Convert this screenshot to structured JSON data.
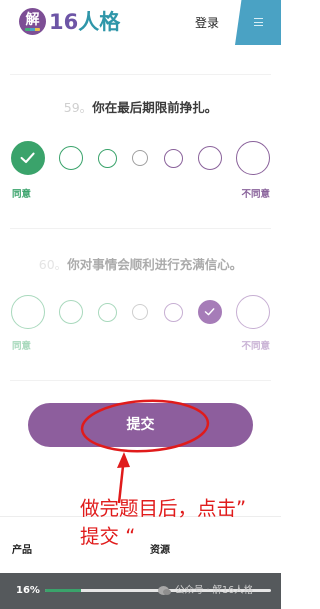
{
  "header": {
    "logo_mark": "解",
    "logo_num": "16",
    "logo_word": "人格",
    "login": "登录",
    "menu_icon": "hamburger-icon"
  },
  "questions": [
    {
      "number": "59。",
      "text": "你在最后期限前挣扎。",
      "agree_label": "同意",
      "disagree_label": "不同意",
      "selected": 0,
      "dimmed": false
    },
    {
      "number": "60。",
      "text": "你对事情会顺利进行充满信心。",
      "agree_label": "同意",
      "disagree_label": "不同意",
      "selected": 5,
      "dimmed": true
    }
  ],
  "submit": {
    "label": "提交"
  },
  "annotation": {
    "line1": "做完题目后，点击”",
    "line2": "提交 “"
  },
  "footer": {
    "col1": "产品",
    "col2": "资源"
  },
  "progress": {
    "label": "16%",
    "value": 0.16
  },
  "watermark": {
    "text": "公众号 · 解16人格",
    "icon": "wechat-icon"
  },
  "colors": {
    "agree": "#3aa36b",
    "neutral": "#a0a0a0",
    "disagree": "#8a629b",
    "agree_dim": "#a9d9bd",
    "neutral_dim": "#cfcfcf",
    "disagree_dim": "#c7afd3",
    "selected_dim": "#a67cb8",
    "button": "#8d5e9d",
    "annotation": "#e01b1b",
    "progress_fill": "#3aa36b"
  }
}
